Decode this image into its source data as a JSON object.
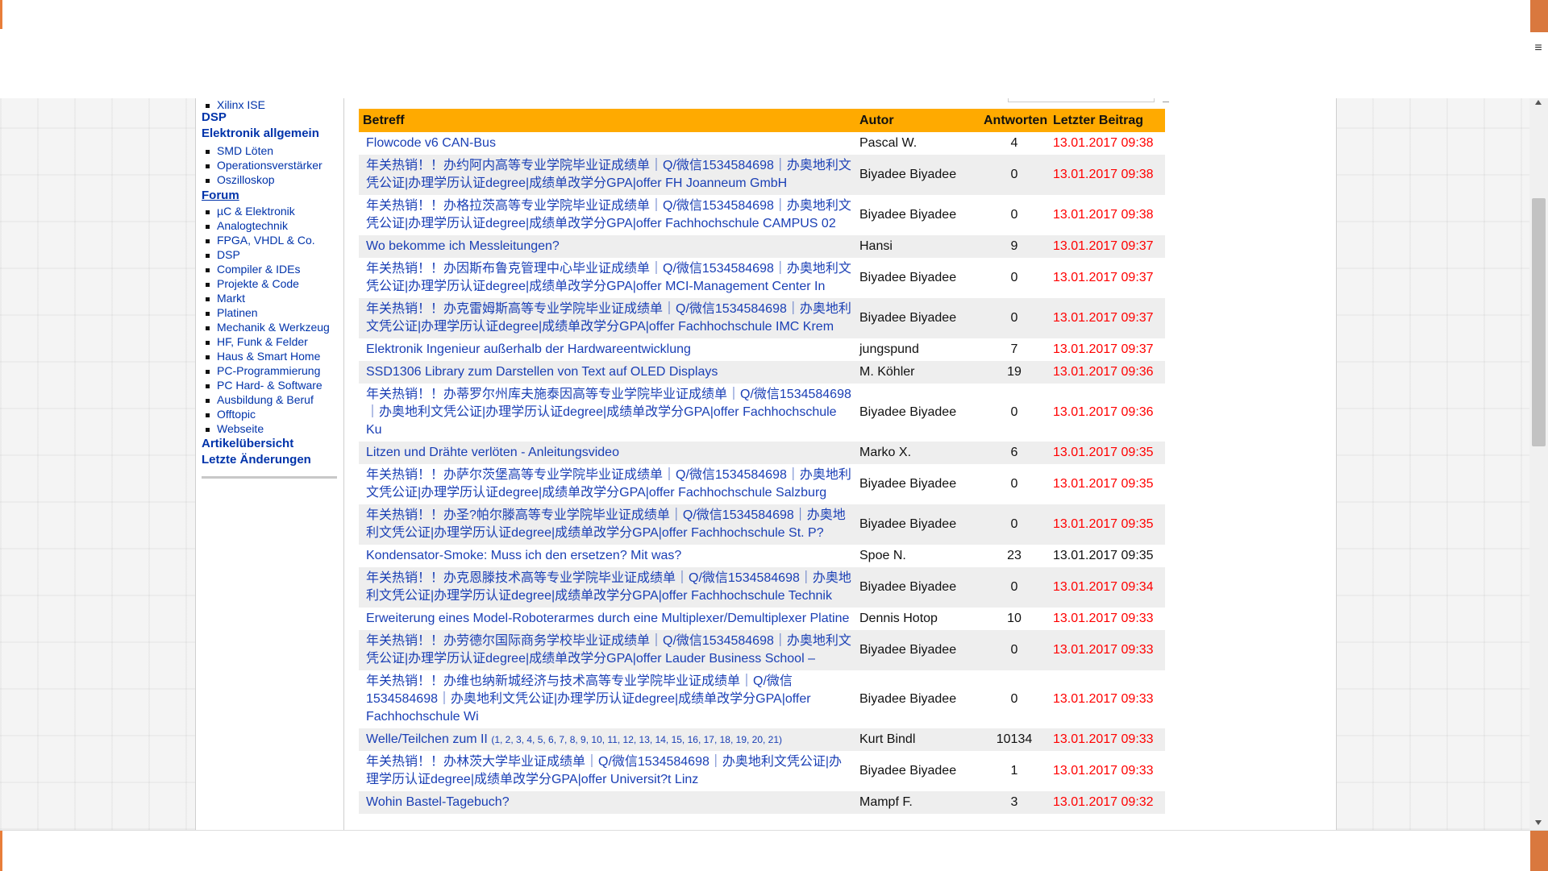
{
  "sidebar": {
    "top_item": "Xilinx ISE",
    "dsp": "DSP",
    "elektronik_allgemein": "Elektronik allgemein",
    "elektronik_items": [
      "SMD Löten",
      "Operationsverstärker",
      "Oszilloskop"
    ],
    "forum": "Forum",
    "forum_items": [
      "µC & Elektronik",
      "Analogtechnik",
      "FPGA, VHDL & Co.",
      "DSP",
      "Compiler & IDEs",
      "Projekte & Code",
      "Markt",
      "Platinen",
      "Mechanik & Werkzeug",
      "HF, Funk & Felder",
      "Haus & Smart Home",
      "PC-Programmierung",
      "PC Hard- & Software",
      "Ausbildung & Beruf",
      "Offtopic",
      "Webseite"
    ],
    "artikeluebersicht": "Artikelübersicht",
    "letzte_aenderungen": "Letzte Änderungen"
  },
  "table": {
    "headers": {
      "betreff": "Betreff",
      "autor": "Autor",
      "antworten": "Antworten",
      "letzter_beitrag": "Letzter Beitrag"
    },
    "rows": [
      {
        "title": "Flowcode v6 CAN-Bus",
        "author": "Pascal W.",
        "replies": "4",
        "date": "13.01.2017 09:38",
        "red": true
      },
      {
        "title": "年关热销！！办约阿内高等专业学院毕业证成绩单｜Q/微信1534584698｜办奥地利文凭公证|办理学历认证degree|成绩单改学分GPA|offer FH Joanneum GmbH",
        "author": "Biyadee Biyadee",
        "replies": "0",
        "date": "13.01.2017 09:38",
        "red": true
      },
      {
        "title": "年关热销！！办格拉茨高等专业学院毕业证成绩单｜Q/微信1534584698｜办奥地利文凭公证|办理学历认证degree|成绩单改学分GPA|offer Fachhochschule CAMPUS 02",
        "author": "Biyadee Biyadee",
        "replies": "0",
        "date": "13.01.2017 09:38",
        "red": true
      },
      {
        "title": "Wo bekomme ich Messleitungen?",
        "author": "Hansi",
        "replies": "9",
        "date": "13.01.2017 09:37",
        "red": true
      },
      {
        "title": "年关热销！！办因斯布鲁克管理中心毕业证成绩单｜Q/微信1534584698｜办奥地利文凭公证|办理学历认证degree|成绩单改学分GPA|offer MCI-Management Center In",
        "author": "Biyadee Biyadee",
        "replies": "0",
        "date": "13.01.2017 09:37",
        "red": true
      },
      {
        "title": "年关热销！！办克雷姆斯高等专业学院毕业证成绩单｜Q/微信1534584698｜办奥地利文凭公证|办理学历认证degree|成绩单改学分GPA|offer Fachhochschule IMC Krem",
        "author": "Biyadee Biyadee",
        "replies": "0",
        "date": "13.01.2017 09:37",
        "red": true
      },
      {
        "title": "Elektronik Ingenieur außerhalb der Hardwareentwicklung",
        "author": "jungspund",
        "replies": "7",
        "date": "13.01.2017 09:37",
        "red": true
      },
      {
        "title": "SSD1306 Library zum Darstellen von Text auf OLED Displays",
        "author": "M. Köhler",
        "replies": "19",
        "date": "13.01.2017 09:36",
        "red": true
      },
      {
        "title": "年关热销！！办蒂罗尔州库夫施泰因高等专业学院毕业证成绩单｜Q/微信1534584698｜办奥地利文凭公证|办理学历认证degree|成绩单改学分GPA|offer Fachhochschule Ku",
        "author": "Biyadee Biyadee",
        "replies": "0",
        "date": "13.01.2017 09:36",
        "red": true
      },
      {
        "title": "Litzen und Drähte verlöten - Anleitungsvideo",
        "author": "Marko X.",
        "replies": "6",
        "date": "13.01.2017 09:35",
        "red": true
      },
      {
        "title": "年关热销！！办萨尔茨堡高等专业学院毕业证成绩单｜Q/微信1534584698｜办奥地利文凭公证|办理学历认证degree|成绩单改学分GPA|offer Fachhochschule Salzburg",
        "author": "Biyadee Biyadee",
        "replies": "0",
        "date": "13.01.2017 09:35",
        "red": true
      },
      {
        "title": "年关热销！！办圣?帕尔滕高等专业学院毕业证成绩单｜Q/微信1534584698｜办奥地利文凭公证|办理学历认证degree|成绩单改学分GPA|offer Fachhochschule St. P?",
        "author": "Biyadee Biyadee",
        "replies": "0",
        "date": "13.01.2017 09:35",
        "red": true
      },
      {
        "title": "Kondensator-Smoke: Muss ich den ersetzen? Mit was?",
        "author": "Spoe N.",
        "replies": "23",
        "date": "13.01.2017 09:35",
        "red": false
      },
      {
        "title": "年关热销！！办克恩滕技术高等专业学院毕业证成绩单｜Q/微信1534584698｜办奥地利文凭公证|办理学历认证degree|成绩单改学分GPA|offer Fachhochschule Technik",
        "author": "Biyadee Biyadee",
        "replies": "0",
        "date": "13.01.2017 09:34",
        "red": true
      },
      {
        "title": "Erweiterung eines Model-Roboterarmes durch eine Multiplexer/Demultiplexer Platine",
        "author": "Dennis Hotop",
        "replies": "10",
        "date": "13.01.2017 09:33",
        "red": true
      },
      {
        "title": "年关热销！！办劳德尔国际商务学校毕业证成绩单｜Q/微信1534584698｜办奥地利文凭公证|办理学历认证degree|成绩单改学分GPA|offer Lauder Business School –",
        "author": "Biyadee Biyadee",
        "replies": "0",
        "date": "13.01.2017 09:33",
        "red": true
      },
      {
        "title": "年关热销！！办维也纳新城经济与技术高等专业学院毕业证成绩单｜Q/微信1534584698｜办奥地利文凭公证|办理学历认证degree|成绩单改学分GPA|offer Fachhochschule Wi",
        "author": "Biyadee Biyadee",
        "replies": "0",
        "date": "13.01.2017 09:33",
        "red": true
      },
      {
        "title": "Welle/Teilchen zum II",
        "pages": "(1, 2, 3, 4, 5, 6, 7, 8, 9, 10, 11, 12, 13, 14, 15, 16, 17, 18, 19, 20, 21)",
        "author": "Kurt Bindl",
        "replies": "10134",
        "date": "13.01.2017 09:33",
        "red": true
      },
      {
        "title": "年关热销！！办林茨大学毕业证成绩单｜Q/微信1534584698｜办奥地利文凭公证|办理学历认证degree|成绩单改学分GPA|offer Universit?t Linz",
        "author": "Biyadee Biyadee",
        "replies": "1",
        "date": "13.01.2017 09:33",
        "red": true
      },
      {
        "title": "Wohin Bastel-Tagebuch?",
        "author": "Mampf F.",
        "replies": "3",
        "date": "13.01.2017 09:32",
        "red": true
      }
    ]
  }
}
